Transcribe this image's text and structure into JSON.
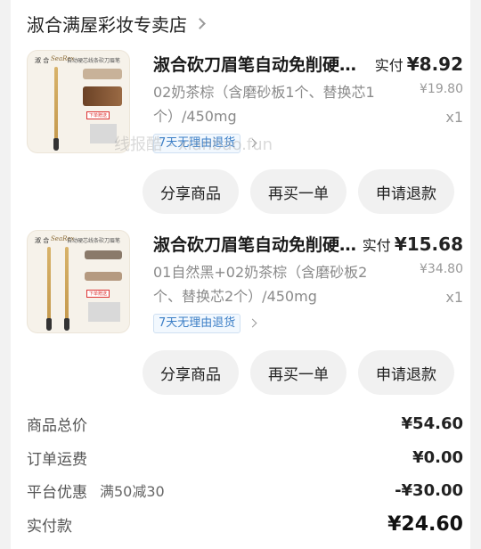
{
  "store": {
    "name": "淑合满屋彩妆专卖店"
  },
  "watermark": "线报酷 - xianbao.fun",
  "thumb": {
    "brand": "淑 合",
    "logo": "SeaRex",
    "caption": "自动硬芯线条砍刀眉笔",
    "badge": "下单赠送"
  },
  "products": [
    {
      "title": "淑合砍刀眉笔自动免削硬芯…",
      "spec": "02奶茶棕（含磨砂板1个、替换芯1个）/450mg",
      "pay_label": "实付",
      "pay_price": "¥8.92",
      "orig_price": "¥19.80",
      "qty": "x1",
      "return_tag": "7天无理由退货",
      "buttons": [
        "分享商品",
        "再买一单",
        "申请退款"
      ]
    },
    {
      "title": "淑合砍刀眉笔自动免削硬芯…",
      "spec": "01自然黑+02奶茶棕（含磨砂板2个、替换芯2个）/450mg",
      "pay_label": "实付",
      "pay_price": "¥15.68",
      "orig_price": "¥34.80",
      "qty": "x1",
      "return_tag": "7天无理由退货",
      "buttons": [
        "分享商品",
        "再买一单",
        "申请退款"
      ]
    }
  ],
  "summary": {
    "goods_total_label": "商品总价",
    "goods_total_value": "¥54.60",
    "shipping_label": "订单运费",
    "shipping_value": "¥0.00",
    "discount_label": "平台优惠",
    "discount_extra": "满50减30",
    "discount_value": "-¥30.00",
    "paid_label": "实付款",
    "paid_value": "¥24.60"
  }
}
